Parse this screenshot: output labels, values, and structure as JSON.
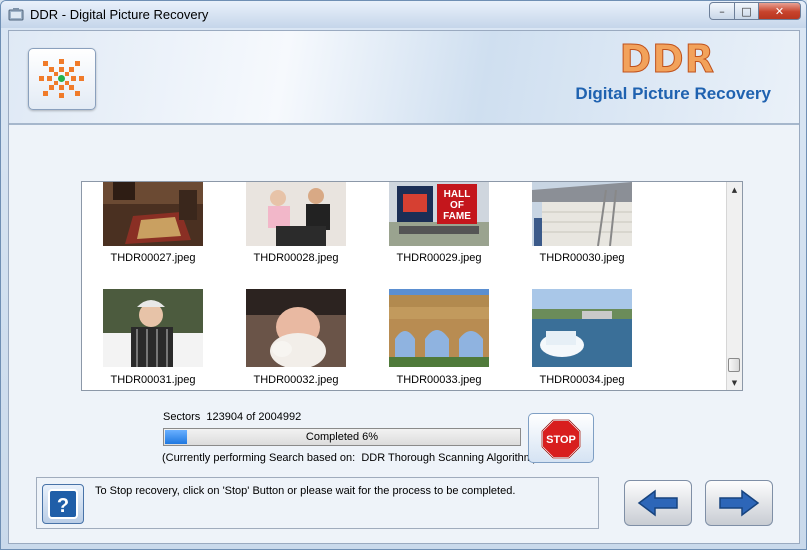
{
  "window": {
    "title": "DDR - Digital Picture Recovery",
    "controls": {
      "minimize": "–",
      "maximize": "□",
      "close": "✕"
    }
  },
  "header": {
    "brand": "DDR",
    "product": "Digital Picture Recovery",
    "colors": {
      "brand_orange": "#f2a25b",
      "product_blue": "#1f62b0"
    }
  },
  "gallery": {
    "items": [
      {
        "label": "THDR00027.jpeg",
        "art": "room"
      },
      {
        "label": "THDR00028.jpeg",
        "art": "people"
      },
      {
        "label": "THDR00029.jpeg",
        "art": "sign"
      },
      {
        "label": "THDR00030.jpeg",
        "art": "house"
      },
      {
        "label": "THDR00031.jpeg",
        "art": "portrait"
      },
      {
        "label": "THDR00032.jpeg",
        "art": "baby"
      },
      {
        "label": "THDR00033.jpeg",
        "art": "aqueduct"
      },
      {
        "label": "THDR00034.jpeg",
        "art": "falls"
      }
    ],
    "sign_text_1": "HALL",
    "sign_text_2": "OF",
    "sign_text_3": "FAME",
    "scroll": {
      "up_icon": "▲",
      "down_icon": "▼"
    }
  },
  "status": {
    "sectors_text": "Sectors  123904 of 2004992",
    "progress_fraction": 0.06,
    "progress_text": "Completed 6%",
    "algorithm_text": "(Currently performing Search based on:  DDR Thorough Scanning Algorithm)",
    "stop_label": "STOP"
  },
  "info": {
    "help_label": "?",
    "message": "To Stop recovery, click on 'Stop' Button or please wait for the process to be completed."
  },
  "nav": {
    "back_icon": "left-arrow-icon",
    "next_icon": "right-arrow-icon"
  }
}
